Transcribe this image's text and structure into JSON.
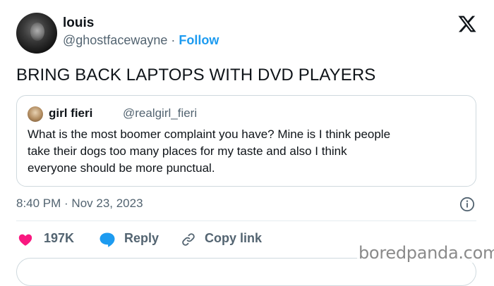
{
  "author": {
    "name": "louis",
    "handle": "@ghostfacewayne",
    "separator": "·",
    "follow_label": "Follow"
  },
  "tweet": {
    "text": "BRING BACK LAPTOPS WITH DVD PLAYERS",
    "timestamp": "8:40 PM · Nov 23, 2023"
  },
  "quoted_tweet": {
    "name": "girl fieri",
    "handle": "@realgirl_fieri",
    "lines": [
      "What is the most boomer complaint you have? Mine is I think people",
      "take their dogs too many places for my taste and also I think",
      "everyone should be more punctual."
    ]
  },
  "actions": {
    "likes_count": "197K",
    "reply_label": "Reply",
    "copy_link_label": "Copy link"
  },
  "watermark": "boredpanda.com",
  "colors": {
    "accent": "#1d9bf0",
    "heart": "#f91880",
    "secondary_text": "#536471",
    "border": "#cfd9de"
  },
  "icons": [
    "x-logo-icon",
    "info-icon",
    "heart-icon",
    "reply-bubble-icon",
    "link-icon"
  ]
}
